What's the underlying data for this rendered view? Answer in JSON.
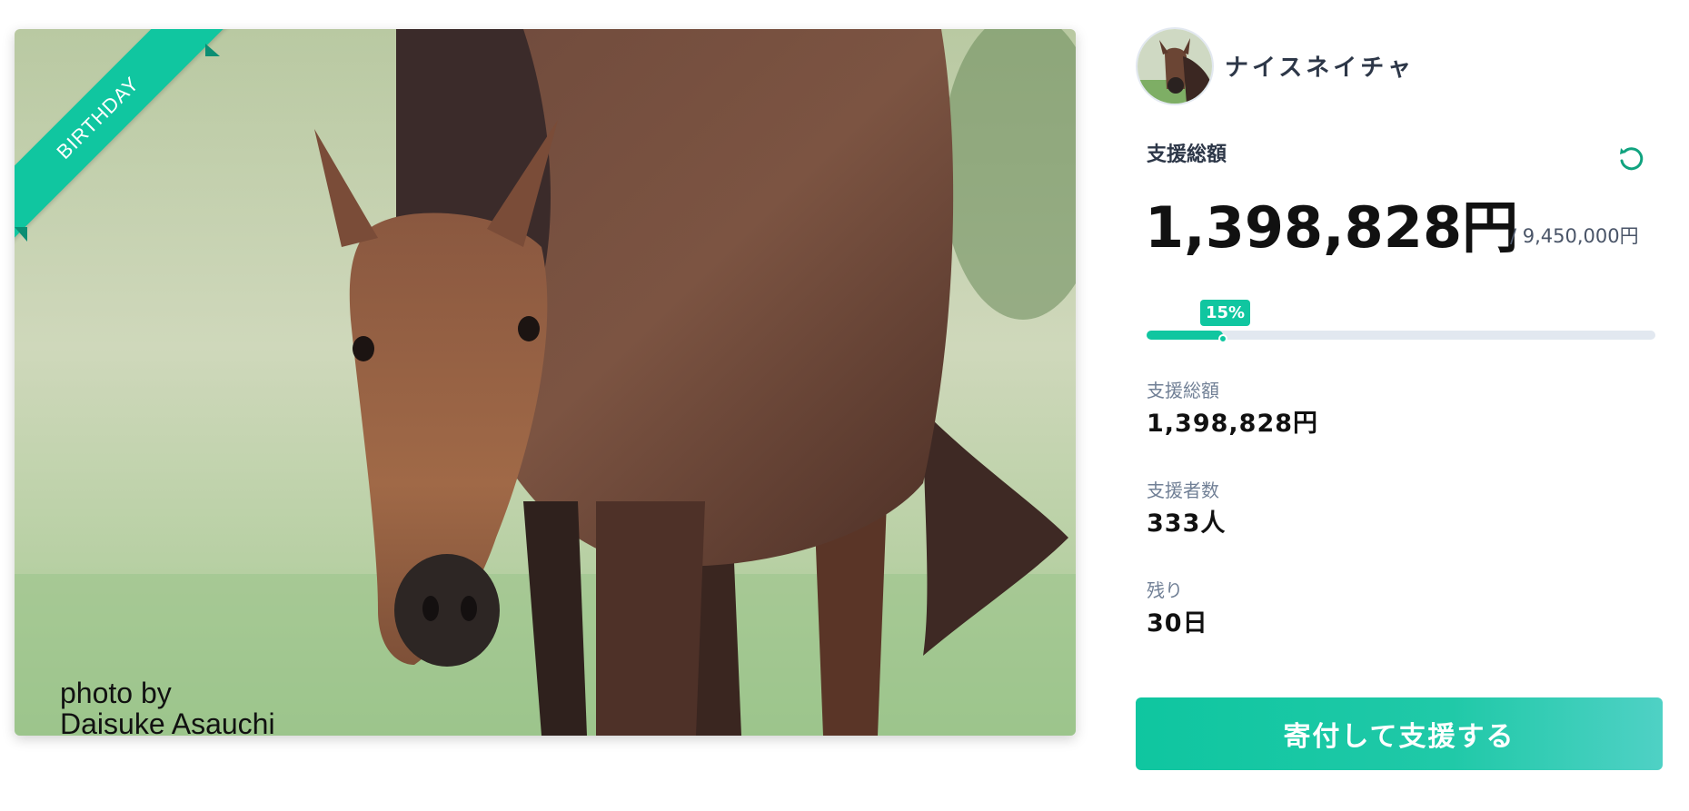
{
  "hero": {
    "ribbon_text": "BIRTHDAY",
    "credit_line1": "photo by",
    "credit_line2": "Daisuke Asauchi"
  },
  "org": {
    "name": "ナイスネイチャ"
  },
  "funding": {
    "label": "支援総額",
    "amount": "1,398,828円",
    "goal": "/ 9,450,000円",
    "progress_percent": 15,
    "progress_label": "15%"
  },
  "stats": [
    {
      "label": "支援総額",
      "value": "1,398,828円"
    },
    {
      "label": "支援者数",
      "value": "333人"
    },
    {
      "label": "残り",
      "value": "30日"
    }
  ],
  "cta": {
    "label": "寄付して支援する"
  },
  "colors": {
    "accent": "#10c6a0",
    "track": "#e2e8f0"
  },
  "icons": {
    "refresh": "refresh-icon"
  }
}
